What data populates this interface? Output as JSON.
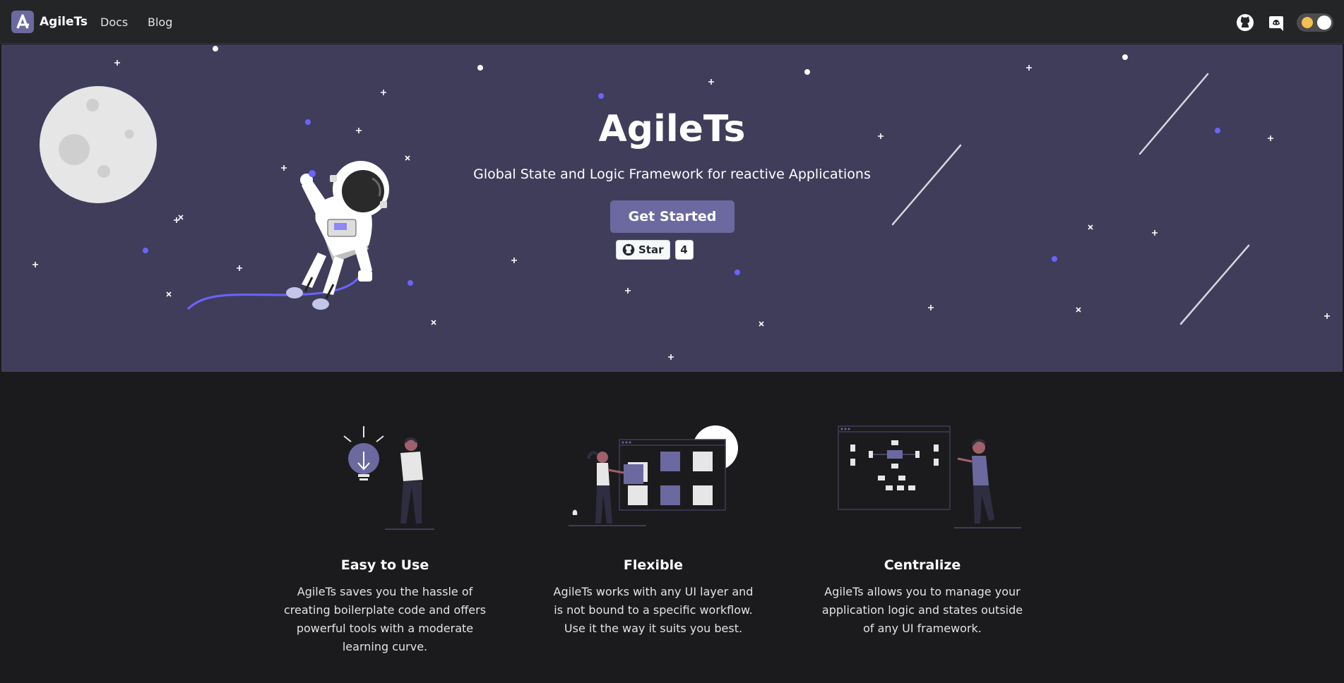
{
  "navbar": {
    "brand": "AgileTs",
    "links": [
      "Docs",
      "Blog"
    ],
    "icons": [
      "github-icon",
      "discord-icon",
      "theme-toggle"
    ]
  },
  "hero": {
    "title": "AgileTs",
    "subtitle": "Global State and Logic Framework for reactive Applications",
    "cta_label": "Get Started",
    "github_star_label": "Star",
    "github_star_count": "4"
  },
  "features": [
    {
      "title": "Easy to Use",
      "description": "AgileTs saves you the hassle of creating boilerplate code and offers powerful tools with a moderate learning curve."
    },
    {
      "title": "Flexible",
      "description": "AgileTs works with any UI layer and is not bound to a specific workflow. Use it the way it suits you best."
    },
    {
      "title": "Centralize",
      "description": "AgileTs allows you to manage your application logic and states outside of any UI framework."
    }
  ],
  "colors": {
    "accent": "#6c69a0",
    "hero_bg": "#403d5b",
    "page_bg": "#1b1b1d",
    "navbar_bg": "#242526"
  }
}
